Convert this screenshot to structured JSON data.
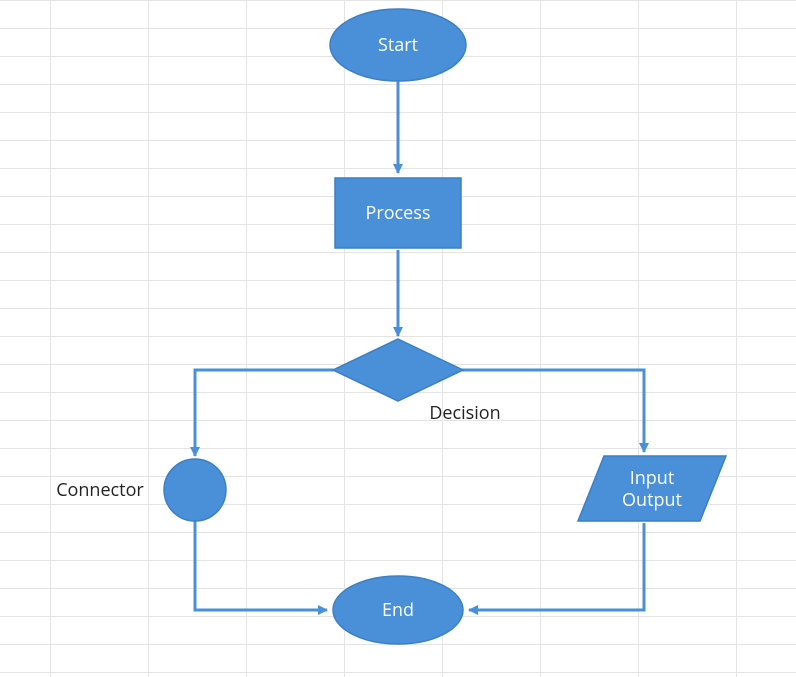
{
  "flowchart": {
    "nodes": {
      "start": {
        "label": "Start",
        "type": "terminator"
      },
      "process": {
        "label": "Process",
        "type": "process"
      },
      "decision": {
        "label": "Decision",
        "type": "decision"
      },
      "connector": {
        "label": "Connector",
        "type": "connector"
      },
      "io": {
        "label_line1": "Input",
        "label_line2": "Output",
        "type": "io"
      },
      "end": {
        "label": "End",
        "type": "terminator"
      }
    },
    "colors": {
      "shape_fill": "#4a90d9",
      "shape_stroke": "#3b7fc4",
      "arrow": "#4a90d9",
      "text_inside": "#ffffff",
      "text_outside": "#222222",
      "grid": "#e4e4e4"
    },
    "edges": [
      {
        "from": "start",
        "to": "process"
      },
      {
        "from": "process",
        "to": "decision"
      },
      {
        "from": "decision",
        "to": "connector"
      },
      {
        "from": "decision",
        "to": "io"
      },
      {
        "from": "connector",
        "to": "end"
      },
      {
        "from": "io",
        "to": "end"
      }
    ]
  }
}
